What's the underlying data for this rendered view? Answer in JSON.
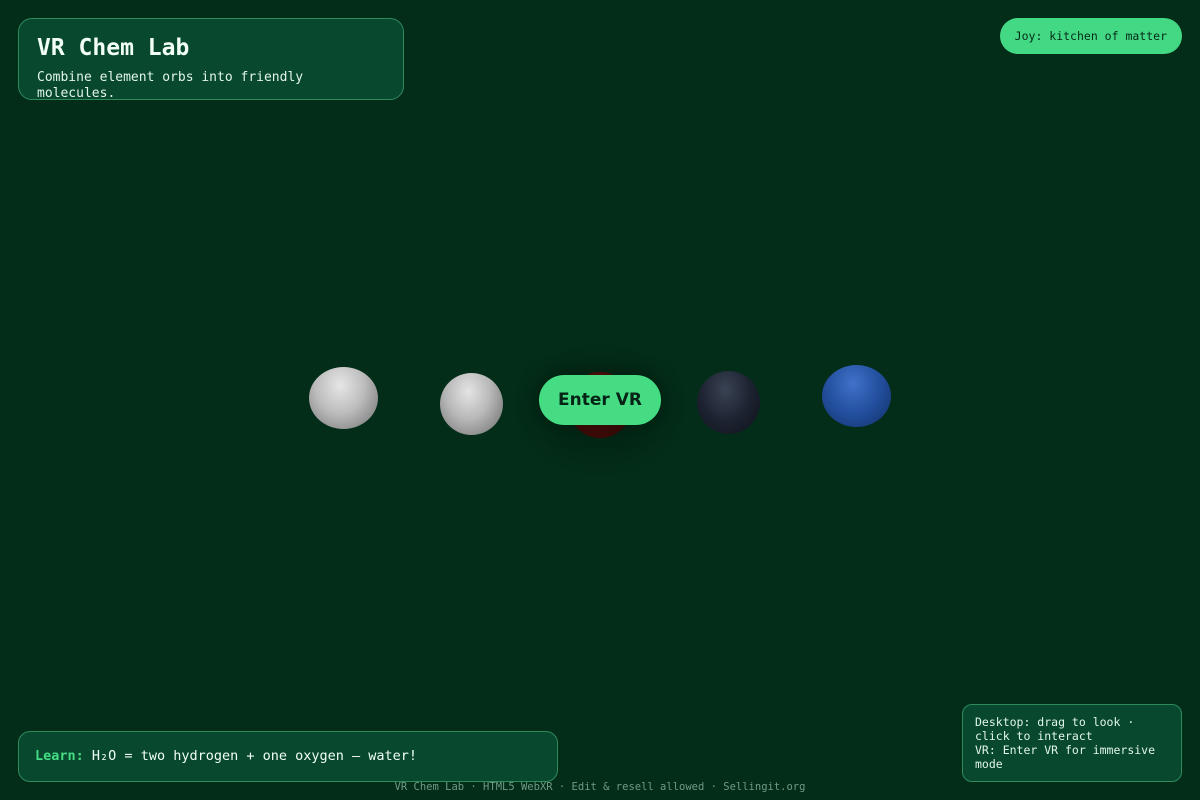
{
  "header": {
    "title": "VR Chem Lab",
    "subtitle": "Combine element orbs into friendly molecules."
  },
  "badge": {
    "label": "Joy: kitchen of matter"
  },
  "scene": {
    "orbs": [
      {
        "element": "hydrogen",
        "color": "#c8c8c8"
      },
      {
        "element": "hydrogen",
        "color": "#c8c8c8"
      },
      {
        "element": "oxygen",
        "color": "#7a0e0e"
      },
      {
        "element": "carbon",
        "color": "#1d2331"
      },
      {
        "element": "nitrogen",
        "color": "#234f9e"
      }
    ],
    "enter_vr_label": "Enter VR"
  },
  "learn": {
    "label": "Learn:",
    "text": "H₂O = two hydrogen + one oxygen — water!"
  },
  "help": {
    "desktop": "Desktop: drag to look · click to interact",
    "vr": "VR: Enter VR for immersive mode"
  },
  "footer": {
    "text": "VR Chem Lab · HTML5 WebXR · Edit & resell allowed · Sellingit.org"
  },
  "colors": {
    "background": "#032d19",
    "panel": "#07482f",
    "accent": "#45dc84"
  }
}
